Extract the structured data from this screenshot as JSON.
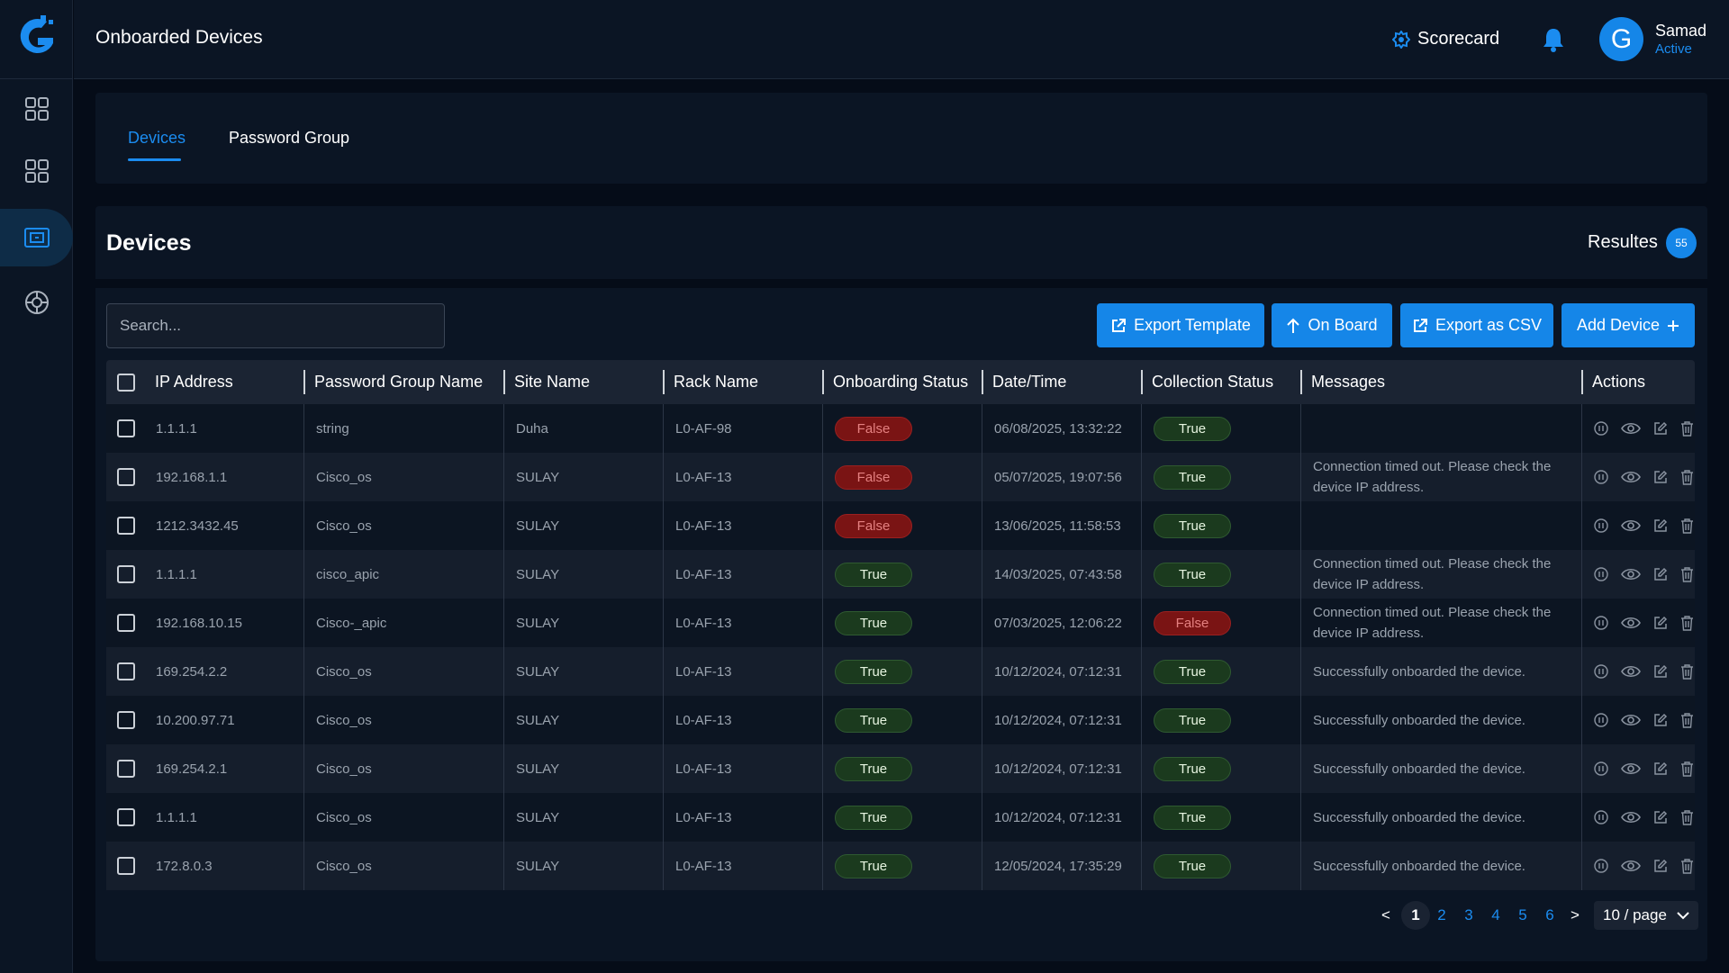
{
  "app": {
    "brand_color": "#1586e8",
    "background": "#050c18",
    "panel": "#0b1524"
  },
  "header": {
    "title": "Onboarded Devices",
    "scorecard_label": "Scorecard",
    "user": {
      "initial": "G",
      "name": "Samad",
      "status": "Active"
    }
  },
  "sidebar": {
    "items": [
      {
        "icon": "grid-icon",
        "active": false
      },
      {
        "icon": "grid-icon",
        "active": false
      },
      {
        "icon": "device-frame-icon",
        "active": true
      },
      {
        "icon": "settings-wheel-icon",
        "active": false
      }
    ]
  },
  "tabs": [
    {
      "label": "Devices",
      "active": true
    },
    {
      "label": "Password Group",
      "active": false
    }
  ],
  "devices": {
    "title": "Devices",
    "results_label": "Resultes",
    "results_count": "55",
    "search_placeholder": "Search...",
    "buttons": {
      "export_template": "Export Template",
      "onboard": "On Board",
      "export_csv": "Export as CSV",
      "add_device": "Add Device"
    }
  },
  "table": {
    "columns": [
      "IP Address",
      "Password Group Name",
      "Site Name",
      "Rack Name",
      "Onboarding Status",
      "Date/Time",
      "Collection Status",
      "Messages",
      "Actions"
    ],
    "rows": [
      {
        "ip": "1.1.1.1",
        "group": "string",
        "site": "Duha",
        "rack": "L0-AF-98",
        "onboarding": "False",
        "datetime": "06/08/2025, 13:32:22",
        "collection": "True",
        "message": ""
      },
      {
        "ip": "192.168.1.1",
        "group": "Cisco_os",
        "site": "SULAY",
        "rack": "L0-AF-13",
        "onboarding": "False",
        "datetime": "05/07/2025, 19:07:56",
        "collection": "True",
        "message": "Connection timed out. Please check the device IP address."
      },
      {
        "ip": "1212.3432.45",
        "group": "Cisco_os",
        "site": "SULAY",
        "rack": "L0-AF-13",
        "onboarding": "False",
        "datetime": "13/06/2025, 11:58:53",
        "collection": "True",
        "message": ""
      },
      {
        "ip": "1.1.1.1",
        "group": "cisco_apic",
        "site": "SULAY",
        "rack": "L0-AF-13",
        "onboarding": "True",
        "datetime": "14/03/2025, 07:43:58",
        "collection": "True",
        "message": "Connection timed out. Please check the device IP address."
      },
      {
        "ip": "192.168.10.15",
        "group": "Cisco-_apic",
        "site": "SULAY",
        "rack": "L0-AF-13",
        "onboarding": "True",
        "datetime": "07/03/2025, 12:06:22",
        "collection": "False",
        "message": "Connection timed out. Please check the device IP address."
      },
      {
        "ip": "169.254.2.2",
        "group": "Cisco_os",
        "site": "SULAY",
        "rack": "L0-AF-13",
        "onboarding": "True",
        "datetime": "10/12/2024, 07:12:31",
        "collection": "True",
        "message": "Successfully onboarded the device."
      },
      {
        "ip": "10.200.97.71",
        "group": "Cisco_os",
        "site": "SULAY",
        "rack": "L0-AF-13",
        "onboarding": "True",
        "datetime": "10/12/2024, 07:12:31",
        "collection": "True",
        "message": "Successfully onboarded the device."
      },
      {
        "ip": "169.254.2.1",
        "group": "Cisco_os",
        "site": "SULAY",
        "rack": "L0-AF-13",
        "onboarding": "True",
        "datetime": "10/12/2024, 07:12:31",
        "collection": "True",
        "message": "Successfully onboarded the device."
      },
      {
        "ip": "1.1.1.1",
        "group": "Cisco_os",
        "site": "SULAY",
        "rack": "L0-AF-13",
        "onboarding": "True",
        "datetime": "10/12/2024, 07:12:31",
        "collection": "True",
        "message": "Successfully onboarded the device."
      },
      {
        "ip": "172.8.0.3",
        "group": "Cisco_os",
        "site": "SULAY",
        "rack": "L0-AF-13",
        "onboarding": "True",
        "datetime": "12/05/2024, 17:35:29",
        "collection": "True",
        "message": "Successfully onboarded the device."
      }
    ],
    "row_actions": [
      "pause-icon",
      "eye-icon",
      "edit-icon",
      "trash-icon"
    ]
  },
  "pagination": {
    "prev": "<",
    "next": ">",
    "pages": [
      "1",
      "2",
      "3",
      "4",
      "5",
      "6"
    ],
    "current": "1",
    "page_size": "10 / page"
  }
}
